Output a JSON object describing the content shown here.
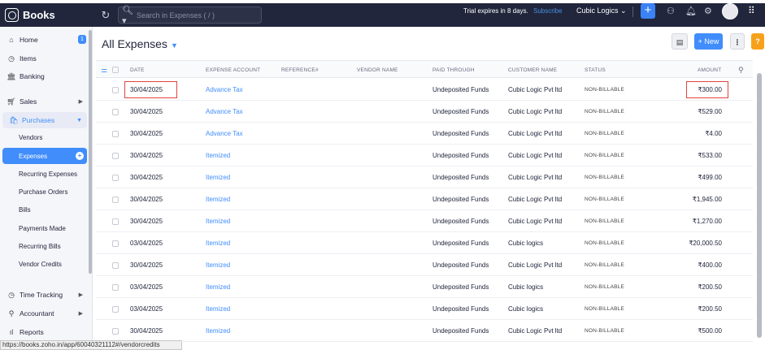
{
  "topbar": {
    "brand": "Books",
    "search_placeholder": "Search in Expenses ( / )",
    "trial": "Trial expires in 8 days.",
    "subscribe": "Subscribe",
    "org": "Cubic Logics ⌄"
  },
  "sidebar": {
    "home": "Home",
    "home_badge": "1",
    "items": "Items",
    "banking": "Banking",
    "sales": "Sales",
    "purchases": "Purchases",
    "vendors": "Vendors",
    "expenses": "Expenses",
    "recurring_expenses": "Recurring Expenses",
    "purchase_orders": "Purchase Orders",
    "bills": "Bills",
    "payments_made": "Payments Made",
    "recurring_bills": "Recurring Bills",
    "vendor_credits": "Vendor Credits",
    "time_tracking": "Time Tracking",
    "accountant": "Accountant",
    "reports": "Reports"
  },
  "statusbar": "https://books.zoho.in/app/60040321112#/vendorcredits",
  "page": {
    "title": "All Expenses",
    "new_label": "+ New",
    "more_label": "⋮",
    "help_label": "?"
  },
  "columns": [
    "DATE",
    "EXPENSE ACCOUNT",
    "REFERENCE#",
    "VENDOR NAME",
    "PAID THROUGH",
    "CUSTOMER NAME",
    "STATUS",
    "AMOUNT"
  ],
  "rows": [
    {
      "date": "30/04/2025",
      "account": "Advance Tax",
      "paid": "Undeposited Funds",
      "customer": "Cubic Logic Pvt ltd",
      "status": "NON-BILLABLE",
      "amount": "₹300.00"
    },
    {
      "date": "30/04/2025",
      "account": "Advance Tax",
      "paid": "Undeposited Funds",
      "customer": "Cubic Logic Pvt ltd",
      "status": "NON-BILLABLE",
      "amount": "₹529.00"
    },
    {
      "date": "30/04/2025",
      "account": "Advance Tax",
      "paid": "Undeposited Funds",
      "customer": "Cubic Logic Pvt ltd",
      "status": "NON-BILLABLE",
      "amount": "₹4.00"
    },
    {
      "date": "30/04/2025",
      "account": "Itemized",
      "paid": "Undeposited Funds",
      "customer": "Cubic Logic Pvt ltd",
      "status": "NON-BILLABLE",
      "amount": "₹533.00"
    },
    {
      "date": "30/04/2025",
      "account": "Itemized",
      "paid": "Undeposited Funds",
      "customer": "Cubic Logic Pvt ltd",
      "status": "NON-BILLABLE",
      "amount": "₹499.00"
    },
    {
      "date": "30/04/2025",
      "account": "Itemized",
      "paid": "Undeposited Funds",
      "customer": "Cubic Logic Pvt ltd",
      "status": "NON-BILLABLE",
      "amount": "₹1,945.00"
    },
    {
      "date": "30/04/2025",
      "account": "Itemized",
      "paid": "Undeposited Funds",
      "customer": "Cubic Logic Pvt ltd",
      "status": "NON-BILLABLE",
      "amount": "₹1,270.00"
    },
    {
      "date": "03/04/2025",
      "account": "Itemized",
      "paid": "Undeposited Funds",
      "customer": "Cubic logics",
      "status": "NON-BILLABLE",
      "amount": "₹20,000.50"
    },
    {
      "date": "30/04/2025",
      "account": "Itemized",
      "paid": "Undeposited Funds",
      "customer": "Cubic Logic Pvt ltd",
      "status": "NON-BILLABLE",
      "amount": "₹400.00"
    },
    {
      "date": "03/04/2025",
      "account": "Itemized",
      "paid": "Undeposited Funds",
      "customer": "Cubic logics",
      "status": "NON-BILLABLE",
      "amount": "₹200.50"
    },
    {
      "date": "03/04/2025",
      "account": "Itemized",
      "paid": "Undeposited Funds",
      "customer": "Cubic logics",
      "status": "NON-BILLABLE",
      "amount": "₹200.50"
    },
    {
      "date": "30/04/2025",
      "account": "Itemized",
      "paid": "Undeposited Funds",
      "customer": "Cubic Logic Pvt ltd",
      "status": "NON-BILLABLE",
      "amount": "₹500.00"
    }
  ]
}
